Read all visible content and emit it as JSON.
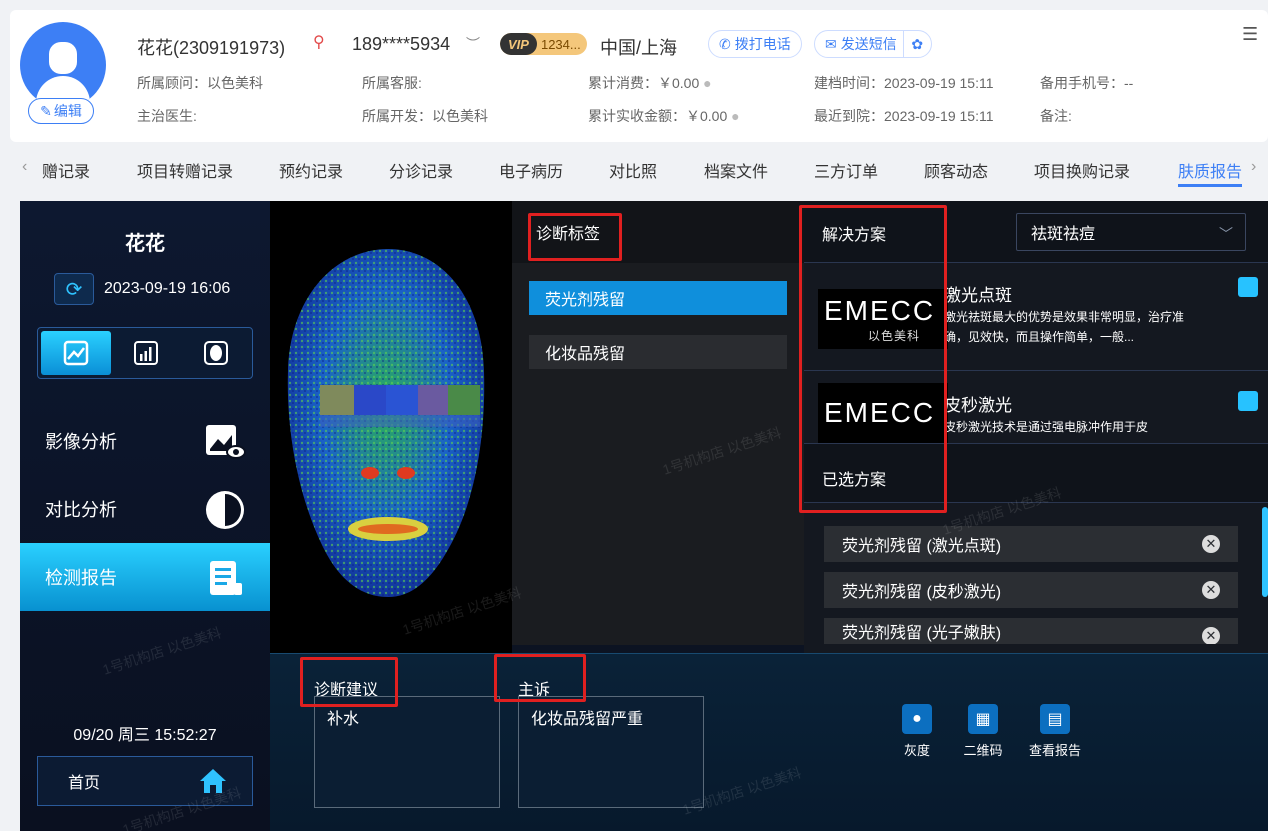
{
  "header": {
    "name": "花花(2309191973)",
    "phone": "189****5934",
    "vip_badge": "VIP",
    "vip_number": "1234...",
    "region": "中国/上海",
    "call_button": "拨打电话",
    "sms_button": "发送短信",
    "edit_button": "编辑",
    "consultant": "所属顾问：以色美科",
    "doctor": "主治医生:",
    "service": "所属客服:",
    "developer": "所属开发：以色美科",
    "total_spent": "累计消费：￥0.00",
    "total_received": "累计实收金额：￥0.00",
    "created": "建档时间：2023-09-19 15:11",
    "last_visit": "最近到院：2023-09-19 15:11",
    "backup_phone": "备用手机号：--",
    "remark": "备注:"
  },
  "tabs": [
    "赠记录",
    "项目转赠记录",
    "预约记录",
    "分诊记录",
    "电子病历",
    "对比照",
    "档案文件",
    "三方订单",
    "顾客动态",
    "项目换购记录",
    "肤质报告"
  ],
  "active_tab": "肤质报告",
  "sidebar": {
    "customer_name": "花花",
    "date": "2023-09-19 16:06",
    "menu": [
      "影像分析",
      "对比分析",
      "检测报告"
    ],
    "active_menu": "检测报告",
    "clock": "09/20 周三 15:52:27",
    "home": "首页"
  },
  "diagnosis": {
    "title": "诊断标签",
    "tags": [
      "荧光剂残留",
      "化妆品残留"
    ],
    "active_tag": "荧光剂残留"
  },
  "solution": {
    "title": "解决方案",
    "select_value": "祛斑祛痘",
    "logo_text": "EMECC",
    "logo_sub": "以色美科",
    "items": [
      {
        "name": "激光点斑",
        "desc": "激光祛斑最大的优势是效果非常明显，治疗准确，见效快，而且操作简单，一般..."
      },
      {
        "name": "皮秒激光",
        "desc": "皮秒激光技术是通过强电脉冲作用于皮"
      }
    ],
    "selected_title": "已选方案",
    "selected": [
      "荧光剂残留 (激光点斑)",
      "荧光剂残留 (皮秒激光)",
      "荧光剂残留 (光子嫩肤)"
    ]
  },
  "bottom": {
    "advice_label": "诊断建议",
    "advice_value": "补水",
    "complaint_label": "主诉",
    "complaint_value": "化妆品残留严重",
    "actions": [
      "灰度",
      "二维码",
      "查看报告"
    ]
  },
  "watermark": "1号机构店 以色美科"
}
